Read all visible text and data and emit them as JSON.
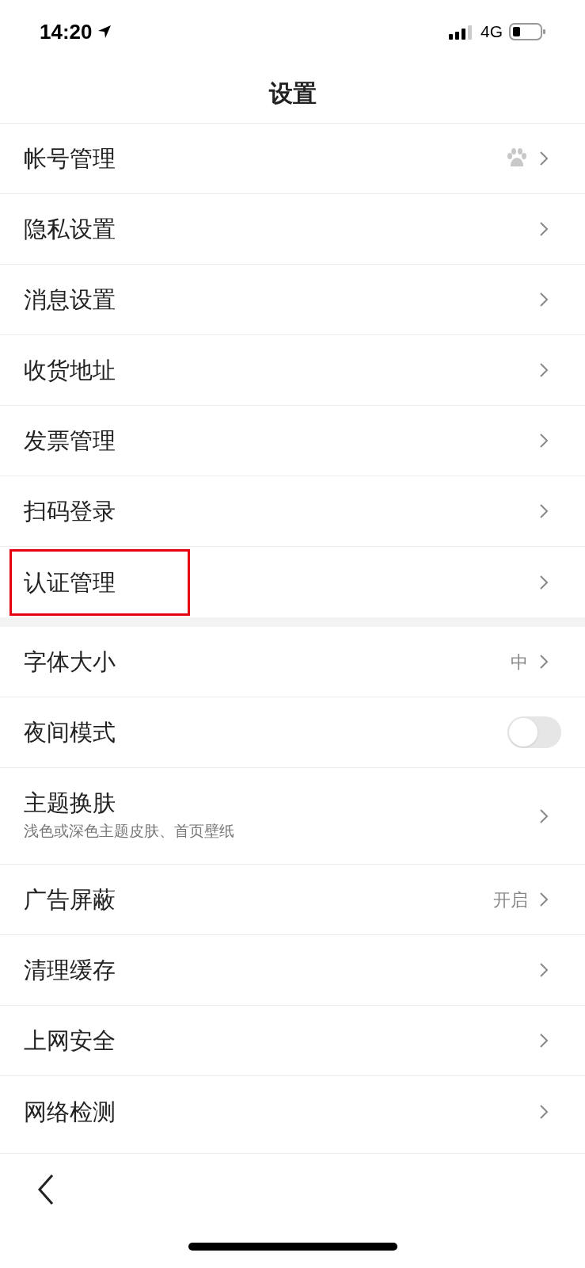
{
  "status_bar": {
    "time": "14:20",
    "network": "4G"
  },
  "header": {
    "title": "设置"
  },
  "sections": [
    {
      "rows": [
        {
          "kind": "link",
          "label": "帐号管理",
          "badge": true,
          "highlighted": false
        },
        {
          "kind": "link",
          "label": "隐私设置",
          "highlighted": false
        },
        {
          "kind": "link",
          "label": "消息设置",
          "highlighted": false
        },
        {
          "kind": "link",
          "label": "收货地址",
          "highlighted": false
        },
        {
          "kind": "link",
          "label": "发票管理",
          "highlighted": false
        },
        {
          "kind": "link",
          "label": "扫码登录",
          "highlighted": false
        },
        {
          "kind": "link",
          "label": "认证管理",
          "highlighted": true
        }
      ]
    },
    {
      "rows": [
        {
          "kind": "link",
          "label": "字体大小",
          "value": "中",
          "highlighted": false
        },
        {
          "kind": "toggle",
          "label": "夜间模式",
          "on": false,
          "highlighted": false
        },
        {
          "kind": "link",
          "label": "主题换肤",
          "subtitle": "浅色或深色主题皮肤、首页壁纸",
          "highlighted": false
        },
        {
          "kind": "link",
          "label": "广告屏蔽",
          "value": "开启",
          "highlighted": false
        },
        {
          "kind": "link",
          "label": "清理缓存",
          "highlighted": false
        },
        {
          "kind": "link",
          "label": "上网安全",
          "highlighted": false
        },
        {
          "kind": "link",
          "label": "网络检测",
          "highlighted": false
        }
      ]
    }
  ]
}
